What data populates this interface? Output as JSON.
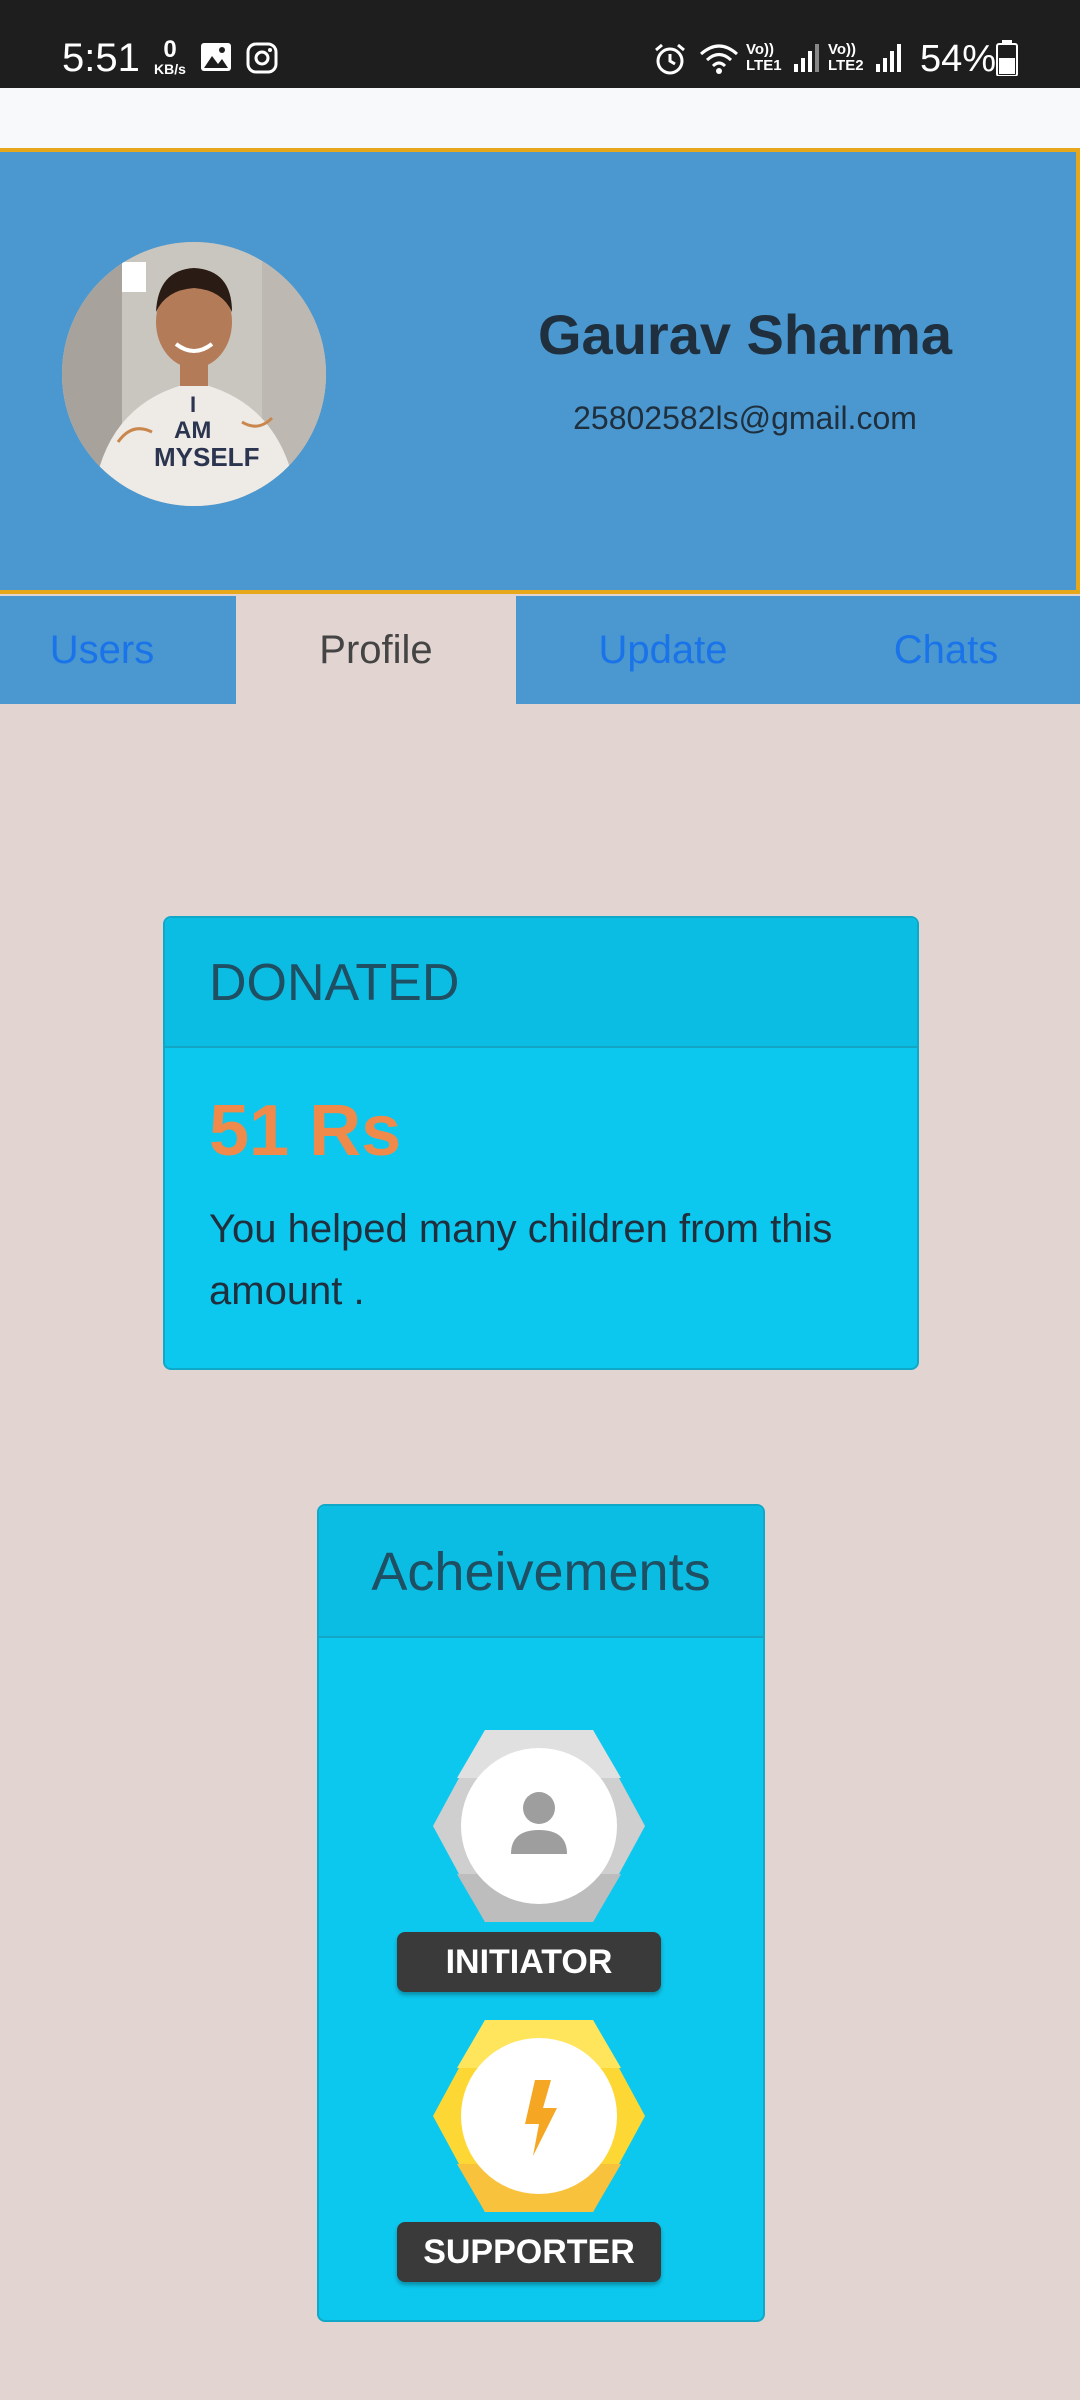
{
  "status_bar": {
    "time": "5:51",
    "net_speed_value": "0",
    "net_speed_unit": "KB/s",
    "sim1": "Vo)) LTE1",
    "sim2": "Vo)) LTE2",
    "battery": "54%"
  },
  "profile": {
    "name": "Gaurav Sharma",
    "email": "25802582ls@gmail.com",
    "avatar_shirt_text": "I AM MYSELF"
  },
  "tabs": [
    {
      "label": "Users"
    },
    {
      "label": "Profile"
    },
    {
      "label": "Update"
    },
    {
      "label": "Chats"
    }
  ],
  "donated": {
    "title": "DONATED",
    "amount": "51 Rs",
    "description": "You helped many children from this amount ."
  },
  "achievements": {
    "title": "Acheivements",
    "badges": [
      {
        "label": "INITIATOR",
        "icon": "person-icon"
      },
      {
        "label": "SUPPORTER",
        "icon": "lightning-icon"
      }
    ]
  },
  "colors": {
    "header_bg": "#4a98cf",
    "header_border": "#e6a81a",
    "page_bg": "#e2d5d1",
    "card_bg": "#0dc8ee",
    "amount": "#ef8a4a",
    "tab_link": "#1a73e8"
  }
}
